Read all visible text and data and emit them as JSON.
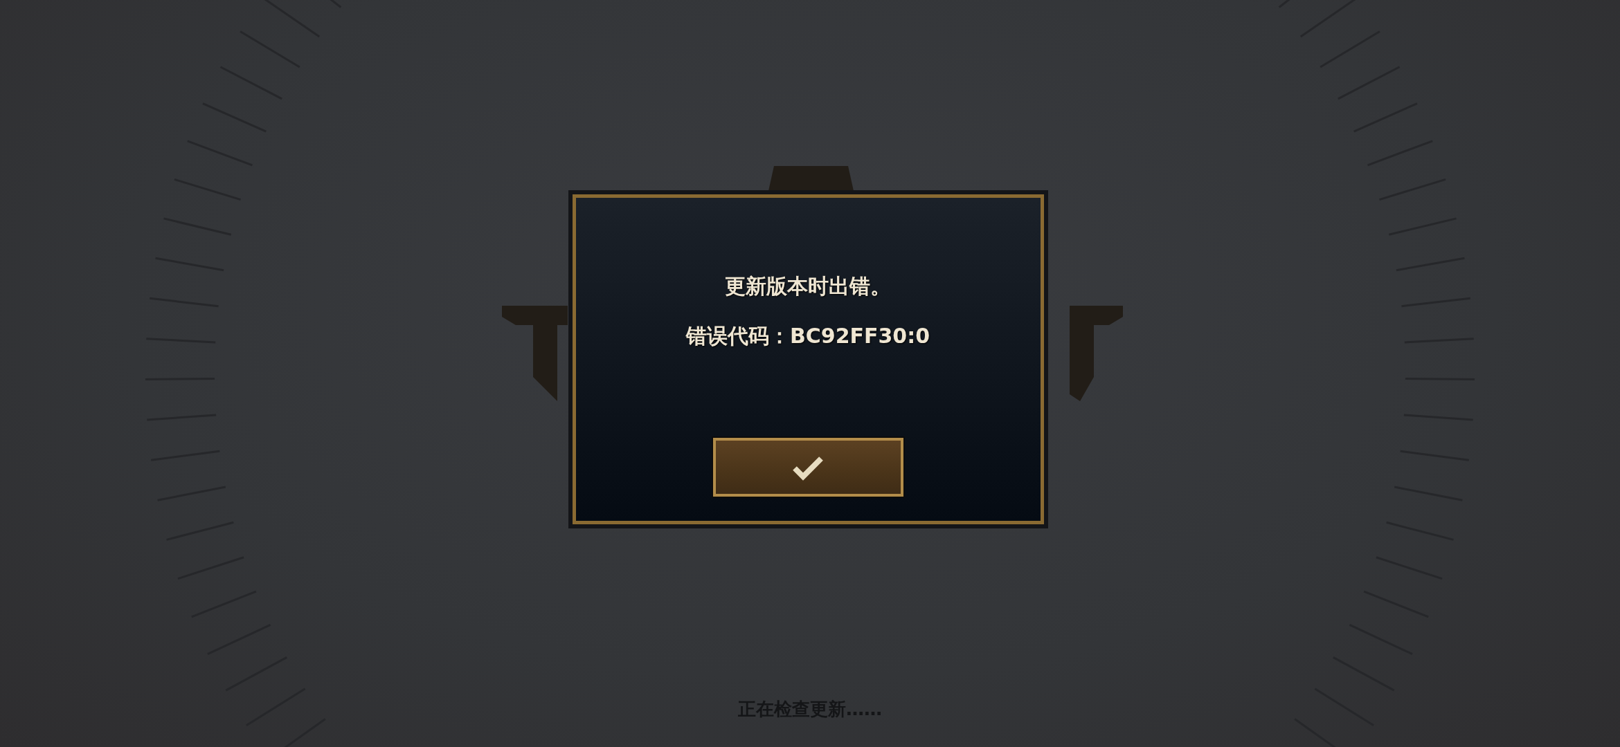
{
  "dialog": {
    "message": "更新版本时出错。",
    "error_code": "错误代码：BC92FF30:0"
  },
  "status_text": "正在检查更新……"
}
